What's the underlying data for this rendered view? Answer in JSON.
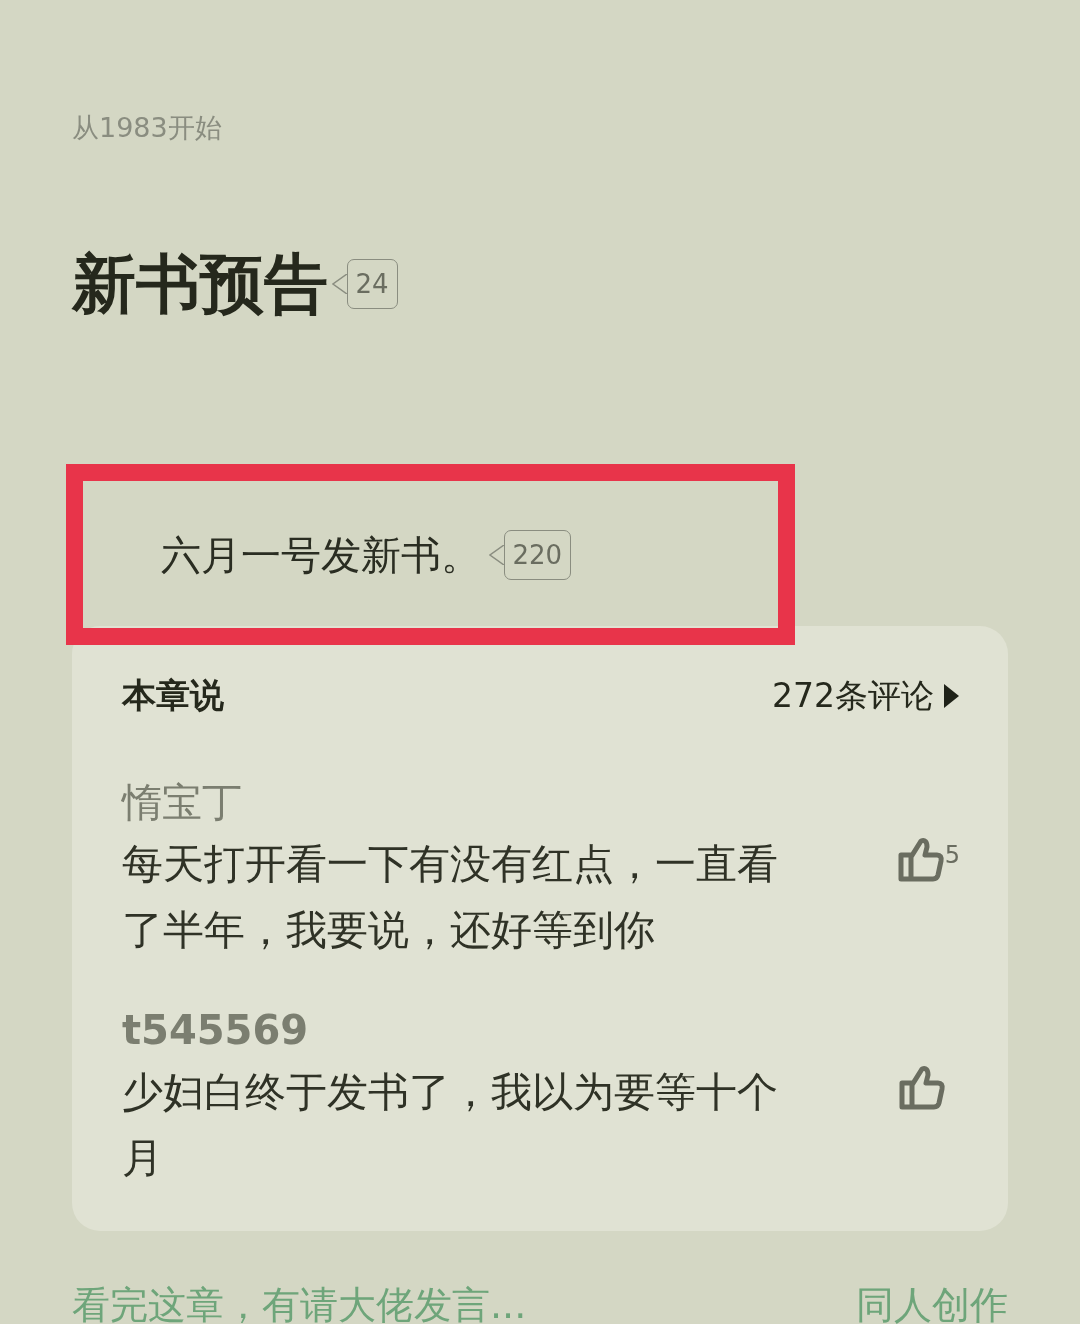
{
  "book_title": "从1983开始",
  "chapter": {
    "title": "新书预告",
    "comment_count": "24"
  },
  "paragraphs": [
    {
      "text": "六月一号发新书。",
      "comment_count": "220",
      "highlighted": true
    }
  ],
  "chapter_comments": {
    "title": "本章说",
    "total": "272条评论",
    "comments": [
      {
        "user": "惰宝丁",
        "text": "每天打开看一下有没有红点，一直看了半年，我要说，还好等到你",
        "likes": "5"
      },
      {
        "user": "t545569",
        "text": "少妇白终于发书了，我以为要等十个月"
      }
    ]
  },
  "footer": {
    "prompt": "看完这章，有请大佬发言...",
    "link": "同人创作"
  }
}
